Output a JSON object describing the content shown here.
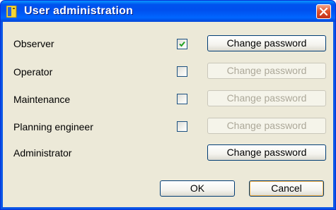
{
  "window": {
    "title": "User administration"
  },
  "rows": [
    {
      "label": "Observer",
      "checked": true,
      "has_checkbox": true,
      "button_label": "Change password",
      "button_enabled": true
    },
    {
      "label": "Operator",
      "checked": false,
      "has_checkbox": true,
      "button_label": "Change password",
      "button_enabled": false
    },
    {
      "label": "Maintenance",
      "checked": false,
      "has_checkbox": true,
      "button_label": "Change password",
      "button_enabled": false
    },
    {
      "label": "Planning engineer",
      "checked": false,
      "has_checkbox": true,
      "button_label": "Change password",
      "button_enabled": false
    },
    {
      "label": "Administrator",
      "has_checkbox": false,
      "button_label": "Change password",
      "button_enabled": true
    }
  ],
  "footer": {
    "ok_label": "OK",
    "cancel_label": "Cancel"
  },
  "colors": {
    "titlebar": "#0054e3",
    "dialog_background": "#ece9d8",
    "checkmark": "#21a121",
    "close_button": "#e0532c"
  }
}
